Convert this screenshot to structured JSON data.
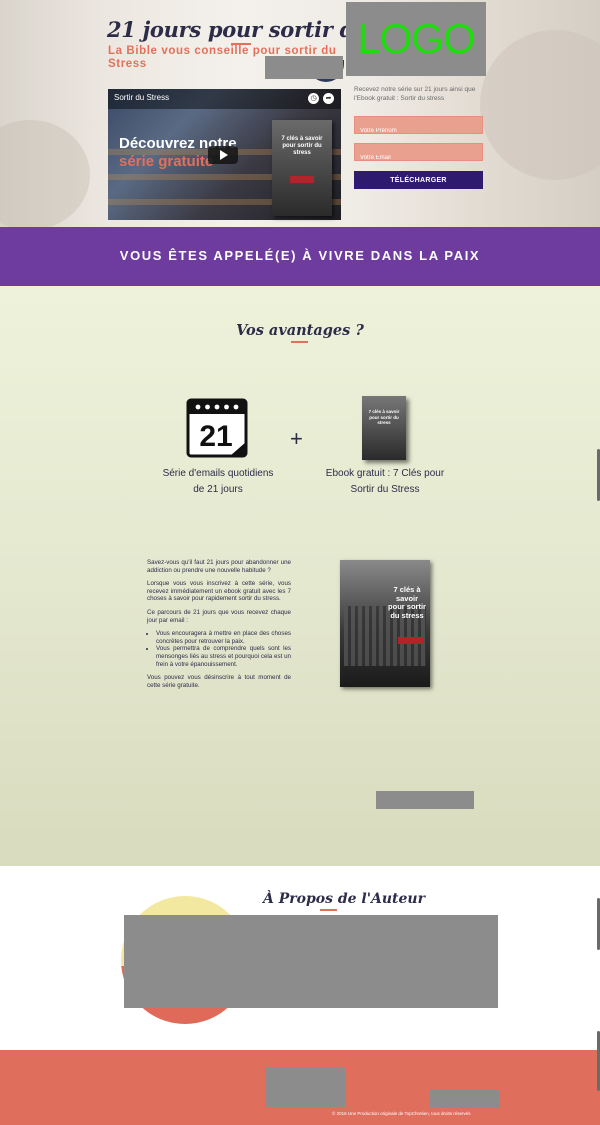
{
  "hero": {
    "title": "21 jours pour sortir du stress",
    "subtitle": "La Bible vous conseille pour sortir du Stress",
    "logo_text": "LOGO"
  },
  "video": {
    "title": "Sortir du Stress",
    "headline_line1": "Découvrez notre",
    "headline_line2": "série gratuite",
    "book_title": "7 clés à savoir pour sortir du stress",
    "icons": [
      "clock-icon",
      "share-icon",
      "play-icon"
    ]
  },
  "form": {
    "intro": "Recevez notre série sur 21 jours ainsi que l'Ebook gratuit : Sortir du stress",
    "first_name_placeholder": "Votre Prénom",
    "email_placeholder": "Votre Email",
    "submit_label": "TÉLÉCHARGER"
  },
  "band": {
    "text": "VOUS ÊTES APPELÉ(E) À VIVRE DANS LA PAIX"
  },
  "advantages": {
    "title": "Vos avantages ?",
    "calendar_number": "21",
    "plus": "+",
    "ebook_cover_text": "7 clés à savoir pour sortir du stress",
    "item1": "Série d'emails quotidiens de 21 jours",
    "item2": "Ebook gratuit : 7 Clés pour Sortir du Stress",
    "paragraphs": [
      "Savez-vous qu'il faut 21 jours pour abandonner une addiction ou prendre une nouvelle habitude ?",
      "Lorsque vous vous inscrivez à cette série, vous recevez immédiatement un ebook gratuit avec les 7 choses à savoir pour rapidement sortir du stress.",
      "Ce parcours de 21 jours que vous recevez chaque jour par email :"
    ],
    "bullets": [
      "Vous encouragera à mettre en place des choses concrètes pour retrouver la paix.",
      "Vous permettra de comprendre quels sont les mensonges liés au stress et pourquoi cela est un frein à votre épanouissement."
    ],
    "closing": "Vous pouvez vous désinscrire à tout moment de cette série gratuite.",
    "large_book_text": "7 clés à savoir pour sortir du stress"
  },
  "about": {
    "title": "À Propos de l'Auteur"
  },
  "footer": {
    "copyright": "© 2016 Une Production originale de TopChretien, tous droits réservés"
  },
  "colors": {
    "purple": "#6e3b9e",
    "coral": "#e06e5c",
    "navy": "#2c2c49",
    "button": "#2e1a6e",
    "logo_text": "#1fdc0f"
  }
}
